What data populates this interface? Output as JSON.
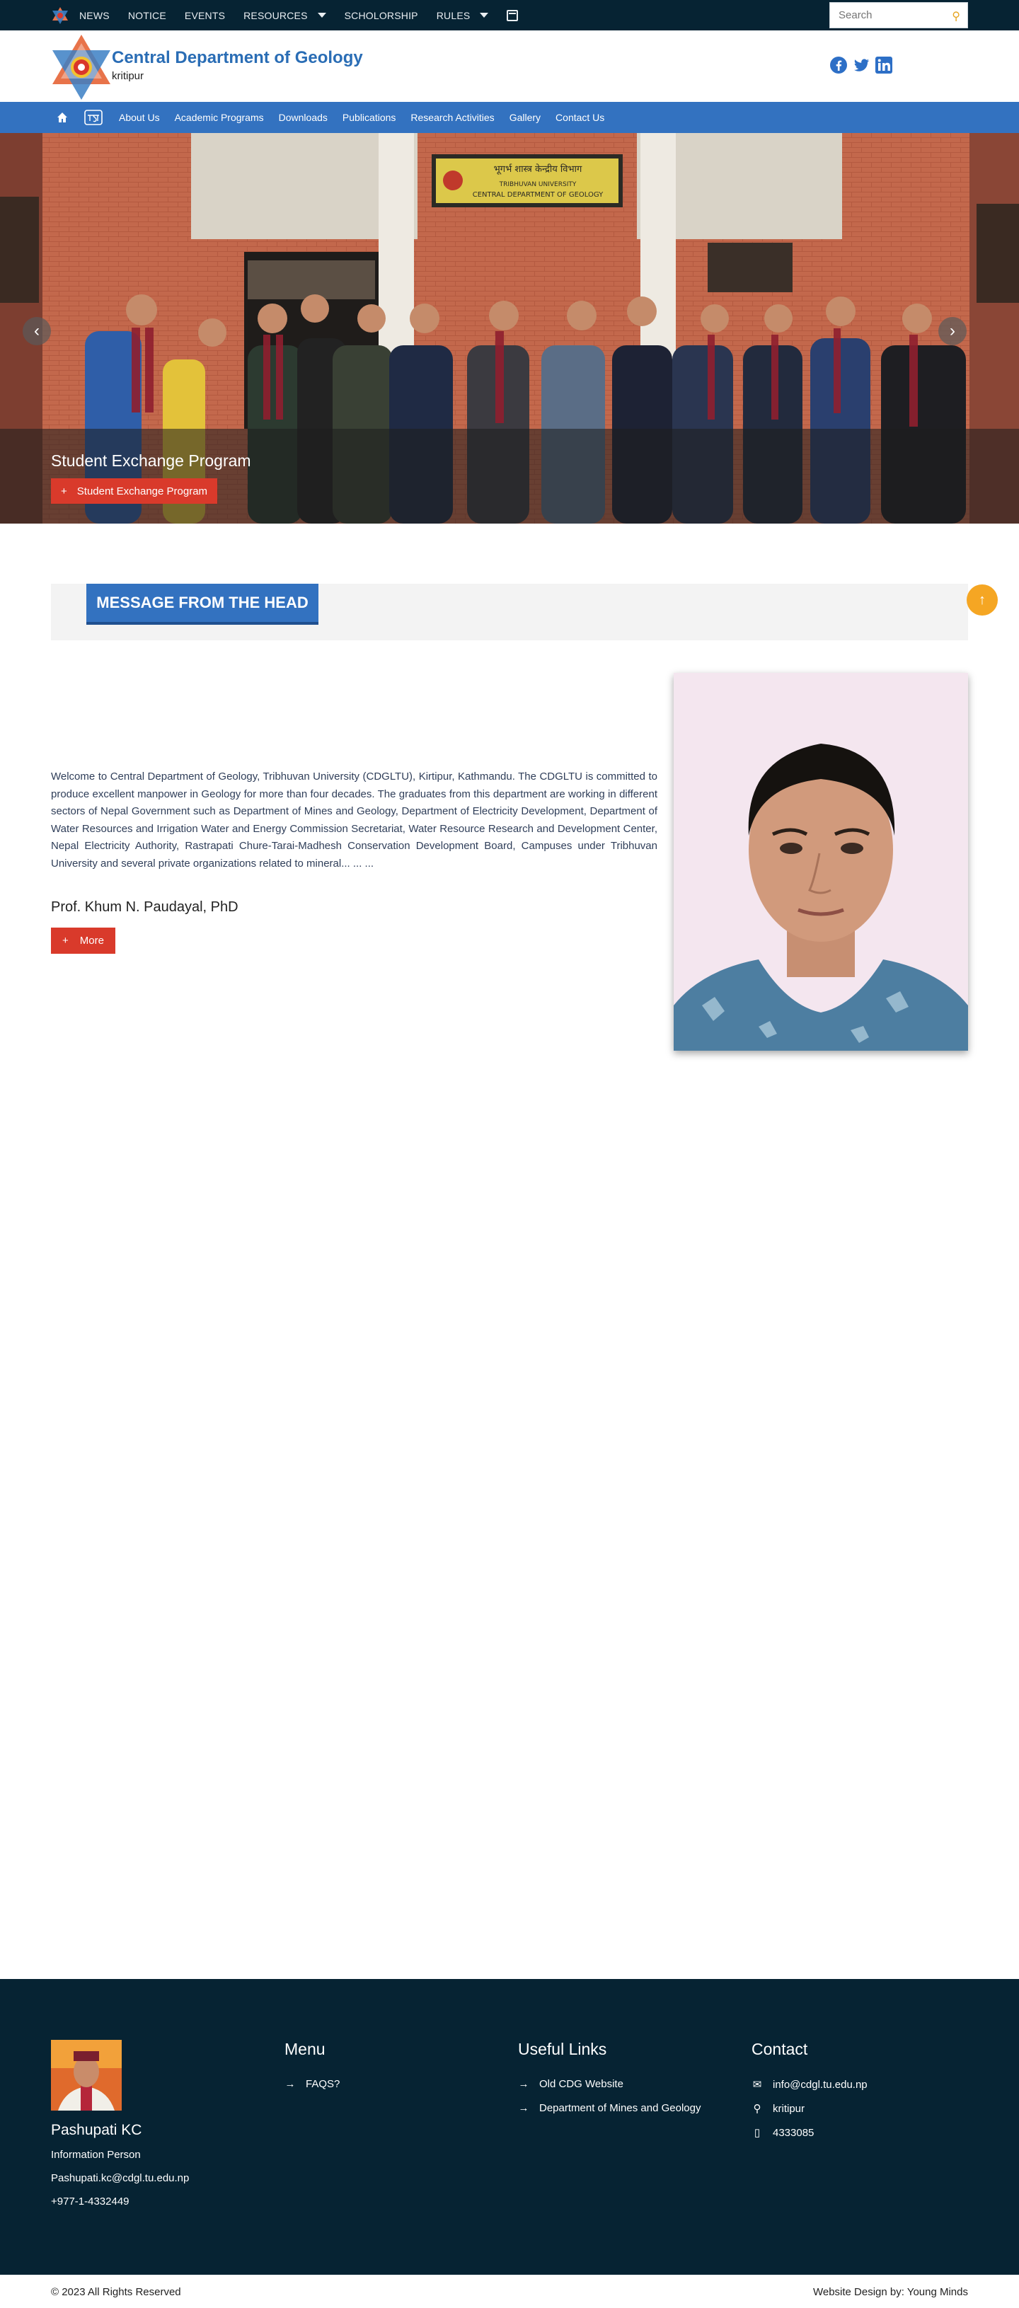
{
  "topbar": {
    "items": [
      "NEWS",
      "NOTICE",
      "EVENTS",
      "RESOURCES",
      "SCHOLORSHIP",
      "RULES"
    ],
    "search_placeholder": "Search"
  },
  "header": {
    "title": "Central Department of Geology",
    "subtitle": "kritipur",
    "social": [
      "facebook-icon",
      "twitter-icon",
      "linkedin-icon"
    ]
  },
  "mainnav": {
    "items": [
      "About Us",
      "Academic Programs",
      "Downloads",
      "Publications",
      "Research Activities",
      "Gallery",
      "Contact Us"
    ]
  },
  "hero": {
    "caption_title": "Student Exchange Program",
    "button_label": "Student Exchange Program",
    "prev": "‹",
    "next": "›",
    "sign_line1": "भूगर्भ शास्त्र केन्द्रीय विभाग",
    "sign_line2": "TRIBHUVAN UNIVERSITY",
    "sign_line3": "CENTRAL DEPARTMENT OF GEOLOGY"
  },
  "message": {
    "heading": "MESSAGE FROM THE HEAD",
    "text": "Welcome to Central Department of Geology, Tribhuvan University (CDGLTU), Kirtipur, Kathmandu. The CDGLTU is committed to produce excellent manpower in Geology for more than four decades. The graduates from this department are working in different sectors of Nepal Government such as Department of Mines and Geology, Department of Electricity Development, Department of Water Resources and Irrigation Water and Energy Commission Secretariat, Water Resource Research and Development Center, Nepal Electricity Authority, Rastrapati Chure-Tarai-Madhesh Conservation Development Board, Campuses under Tribhuvan University and several private organizations related to mineral... ... ...",
    "name": "Prof. Khum N. Paudayal, PhD",
    "more_label": "More"
  },
  "footer": {
    "person": {
      "name": "Pashupati KC",
      "role": "Information Person",
      "email": "Pashupati.kc@cdgl.tu.edu.np",
      "phone": "+977-1-4332449"
    },
    "menu": {
      "title": "Menu",
      "links": [
        "FAQS?"
      ]
    },
    "useful": {
      "title": "Useful Links",
      "links": [
        "Old CDG Website",
        "Department of Mines and Geology"
      ]
    },
    "contact": {
      "title": "Contact",
      "email": "info@cdgl.tu.edu.np",
      "address": "kritipur",
      "phone": "4333085"
    }
  },
  "bottom": {
    "copyright": "© 2023 All Rights Reserved",
    "design": "Website Design by: Young Minds"
  },
  "colors": {
    "topbar": "#062333",
    "nav_blue": "#3372c0",
    "accent_red": "#d93a2b",
    "scroll_orange": "#f5a623"
  }
}
